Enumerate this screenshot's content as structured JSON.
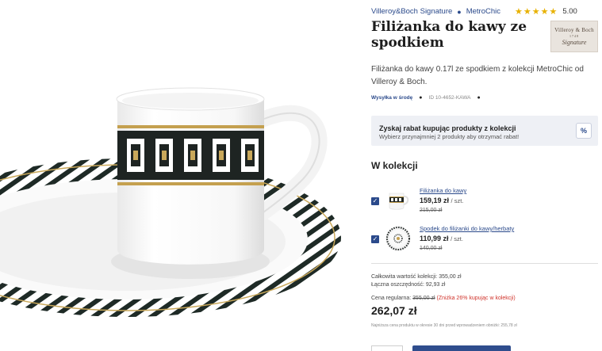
{
  "header": {
    "brand_link": "Villeroy&Boch Signature",
    "collection_link": "MetroChic",
    "rating_stars": "★★★★★",
    "rating_value": "5.00"
  },
  "product": {
    "title": "Filiżanka do kawy ze spodkiem",
    "description": "Filiżanka do kawy 0.17l ze spodkiem z kolekcji MetroChic od Villeroy & Boch.",
    "shipping": "Wysyłka w środę",
    "sku": "ID 10-4652-KAWA"
  },
  "brand_logo": {
    "line1": "Villeroy & Boch",
    "line2": "1748",
    "line3": "Signature"
  },
  "promo": {
    "heading": "Zyskaj rabat kupując produkty z kolekcji",
    "subtext": "Wybierz przynajmniej 2 produkty aby otrzymać rabat!",
    "icon_label": "%"
  },
  "collection": {
    "title": "W kolekcji",
    "items": [
      {
        "name": "Filiżanka do kawy",
        "price": "159,19 zł",
        "unit": "/ szt.",
        "old_price": "215,00 zł",
        "checked": true
      },
      {
        "name": "Spodek do filiżanki do kawy/herbaty",
        "price": "110,99 zł",
        "unit": "/ szt.",
        "old_price": "140,00 zł",
        "checked": true
      }
    ]
  },
  "summary": {
    "total_value": "Całkowita wartość kolekcji: 355,00 zł",
    "savings": "Łączna oszczędność: 92,93 zł",
    "regular_label": "Cena regularna:",
    "regular_price": "355,00 zł",
    "discount_note": "(Zniżka 26% kupując w kolekcji)",
    "final_price": "262,07 zł",
    "lowest_price_note": "Najniższa cena produktu w okresie 30 dni przed wprowadzeniem obniżki: 255,78 zł"
  },
  "colors": {
    "link_blue": "#2b4a8b",
    "star_gold": "#e8b100",
    "discount_red": "#d0342c",
    "button_blue": "#2f4d8d"
  }
}
